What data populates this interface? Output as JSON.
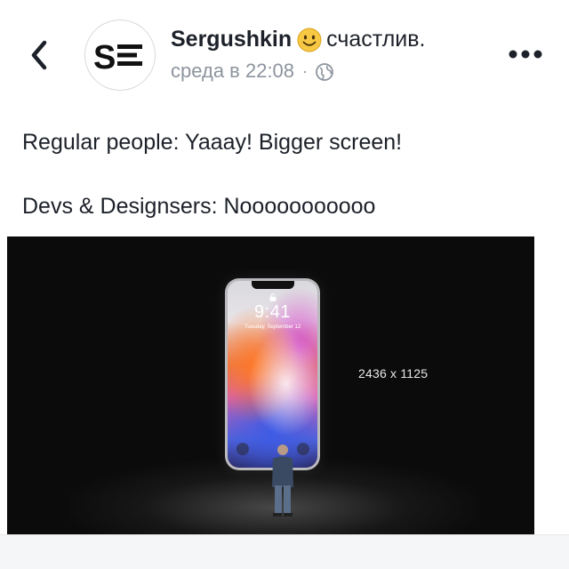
{
  "header": {
    "back_icon": "chevron-left-icon",
    "avatar_logo_text": "SE",
    "author_name": "Sergushkin",
    "feeling_emoji": "smiling-face-icon",
    "feeling_text": "счастлив.",
    "post_time": "среда в 22:08",
    "meta_separator": "·",
    "privacy_icon": "globe-icon",
    "more_icon": "more-dots-icon"
  },
  "post": {
    "lines": [
      "Regular people: Yaaay! Bigger screen!",
      "Devs & Designsers: Nooooooooooo"
    ]
  },
  "photo": {
    "phone_time": "9:41",
    "phone_date": "Tuesday, September 12",
    "resolution_label": "2436 x 1125"
  },
  "colors": {
    "text": "#1d2129",
    "meta": "#8d949e",
    "photo_background": "#0b0b0b"
  }
}
